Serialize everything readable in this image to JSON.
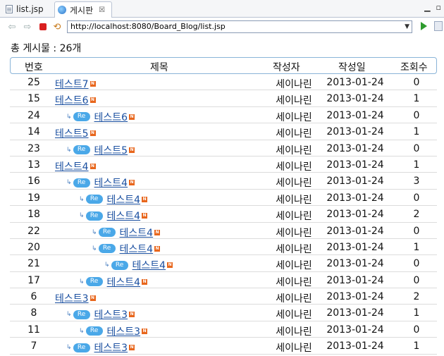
{
  "tabs": [
    {
      "label": "list.jsp",
      "active": false
    },
    {
      "label": "게시판",
      "active": true,
      "close": "☒"
    }
  ],
  "nav": {
    "url": "http://localhost:8080/Board_Blog/list.jsp"
  },
  "board": {
    "total_label": "총 게시물 : 26개",
    "headers": {
      "num": "번호",
      "title": "제목",
      "writer": "작성자",
      "date": "작성일",
      "views": "조회수"
    },
    "rows": [
      {
        "num": "25",
        "title": "테스트7",
        "depth": 0,
        "writer": "세이나린",
        "date": "2013-01-24",
        "views": "0"
      },
      {
        "num": "15",
        "title": "테스트6",
        "depth": 0,
        "writer": "세이나린",
        "date": "2013-01-24",
        "views": "1"
      },
      {
        "num": "24",
        "title": "테스트6",
        "depth": 1,
        "writer": "세이나린",
        "date": "2013-01-24",
        "views": "0"
      },
      {
        "num": "14",
        "title": "테스트5",
        "depth": 0,
        "writer": "세이나린",
        "date": "2013-01-24",
        "views": "1"
      },
      {
        "num": "23",
        "title": "테스트5",
        "depth": 1,
        "writer": "세이나린",
        "date": "2013-01-24",
        "views": "0"
      },
      {
        "num": "13",
        "title": "테스트4",
        "depth": 0,
        "writer": "세이나린",
        "date": "2013-01-24",
        "views": "1"
      },
      {
        "num": "16",
        "title": "테스트4",
        "depth": 1,
        "writer": "세이나린",
        "date": "2013-01-24",
        "views": "3"
      },
      {
        "num": "19",
        "title": "테스트4",
        "depth": 2,
        "writer": "세이나린",
        "date": "2013-01-24",
        "views": "0"
      },
      {
        "num": "18",
        "title": "테스트4",
        "depth": 2,
        "writer": "세이나린",
        "date": "2013-01-24",
        "views": "2"
      },
      {
        "num": "22",
        "title": "테스트4",
        "depth": 3,
        "writer": "세이나린",
        "date": "2013-01-24",
        "views": "0"
      },
      {
        "num": "20",
        "title": "테스트4",
        "depth": 3,
        "writer": "세이나린",
        "date": "2013-01-24",
        "views": "1"
      },
      {
        "num": "21",
        "title": "테스트4",
        "depth": 4,
        "writer": "세이나린",
        "date": "2013-01-24",
        "views": "0"
      },
      {
        "num": "17",
        "title": "테스트4",
        "depth": 2,
        "writer": "세이나린",
        "date": "2013-01-24",
        "views": "0"
      },
      {
        "num": "6",
        "title": "테스트3",
        "depth": 0,
        "writer": "세이나린",
        "date": "2013-01-24",
        "views": "2"
      },
      {
        "num": "8",
        "title": "테스트3",
        "depth": 1,
        "writer": "세이나린",
        "date": "2013-01-24",
        "views": "1"
      },
      {
        "num": "11",
        "title": "테스트3",
        "depth": 2,
        "writer": "세이나린",
        "date": "2013-01-24",
        "views": "0"
      },
      {
        "num": "7",
        "title": "테스트3",
        "depth": 1,
        "writer": "세이나린",
        "date": "2013-01-24",
        "views": "1"
      }
    ],
    "re_badge": "Re",
    "new_badge": "N",
    "reply_arrow": "↳"
  },
  "colors": {
    "link": "#1a4fa0",
    "re_badge": "#4aa8e8",
    "new_badge": "#e8661c",
    "header_border": "#8ab4d8"
  },
  "icons": [
    "file-icon",
    "globe-icon",
    "back-arrow-icon",
    "forward-arrow-icon",
    "stop-icon",
    "refresh-icon",
    "go-icon"
  ]
}
